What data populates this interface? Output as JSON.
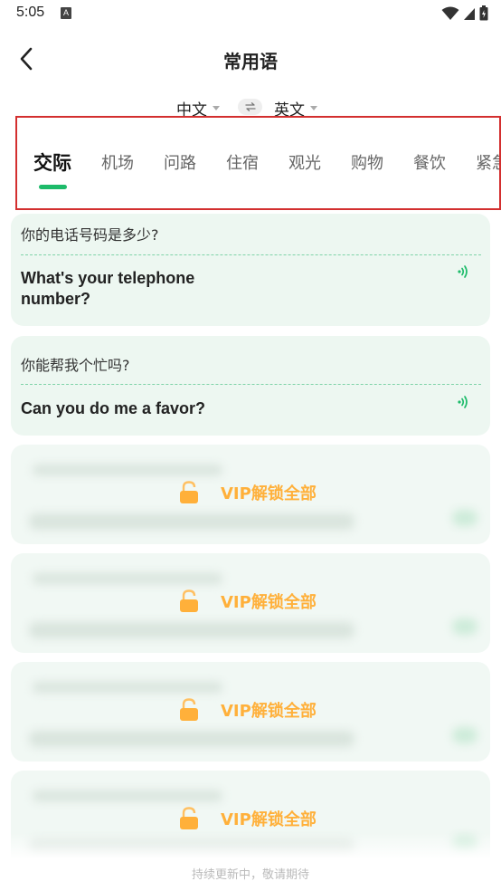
{
  "status_bar": {
    "time": "5:05",
    "notification_letter": "A",
    "icons": [
      "wifi-icon",
      "signal-icon",
      "battery-icon"
    ]
  },
  "header": {
    "title": "常用语",
    "back_icon": "chevron-left-icon"
  },
  "languages": {
    "source": "中文",
    "target": "英文",
    "swap_icon": "swap-arrows-icon"
  },
  "tabs": [
    {
      "label": "交际",
      "active": true
    },
    {
      "label": "机场",
      "active": false
    },
    {
      "label": "问路",
      "active": false
    },
    {
      "label": "住宿",
      "active": false
    },
    {
      "label": "观光",
      "active": false
    },
    {
      "label": "购物",
      "active": false
    },
    {
      "label": "餐饮",
      "active": false
    },
    {
      "label": "紧急",
      "active": false
    }
  ],
  "phrases": [
    {
      "zh": "你的电话号码是多少?",
      "en_line1": "What's your telephone",
      "en_line2": "number?"
    },
    {
      "zh": "你能帮我个忙吗?",
      "en_line1": "Can you do me a favor?",
      "en_line2": ""
    }
  ],
  "locked": {
    "label": "VIP解锁全部",
    "count": 4,
    "icon": "lock-icon"
  },
  "footer": {
    "note": "持续更新中，敬请期待"
  },
  "colors": {
    "accent_green": "#1dbb6a",
    "vip_orange": "#ffb03a",
    "card_bg": "#edf7f1",
    "highlight_border": "#d32f2f"
  }
}
